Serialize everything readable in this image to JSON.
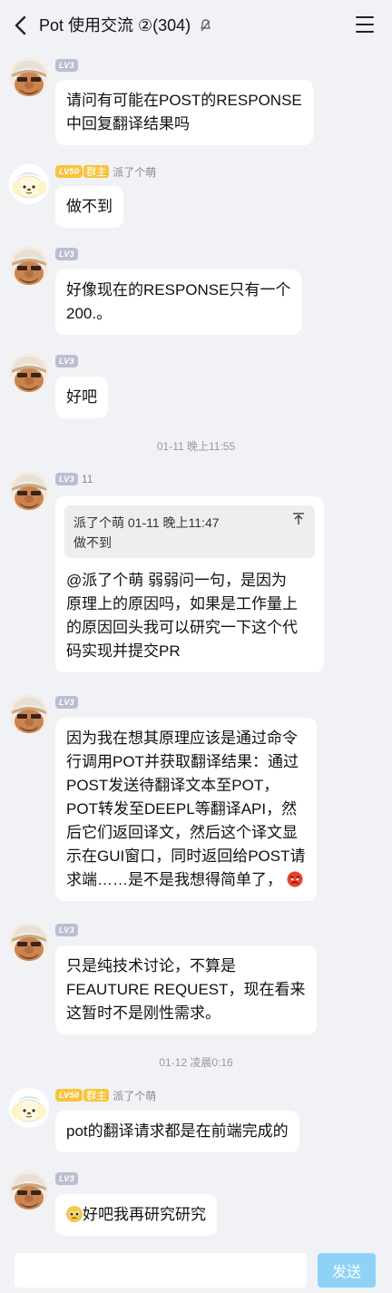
{
  "header": {
    "title": "Pot 使用交流 ②(304)"
  },
  "messages": [
    {
      "level": "LV3",
      "lines": [
        "请问有可能在POST的RESPONSE",
        "中回复翻译结果吗"
      ]
    },
    {
      "level": "LV50",
      "role": "群主",
      "name": "派了个萌",
      "lines": [
        "做不到"
      ]
    },
    {
      "level": "LV3",
      "lines": [
        "好像现在的RESPONSE只有一个",
        "200.。"
      ]
    },
    {
      "level": "LV3",
      "lines": [
        "好吧"
      ]
    },
    {
      "level": "LV3",
      "name": "11",
      "quote": {
        "header": "派了个萌 01-11 晚上11:47",
        "text": "做不到"
      },
      "lines": [
        "@派了个萌  弱弱问一句，是因为",
        "原理上的原因吗，如果是工作量上",
        "的原因回头我可以研究一下这个代",
        "码实现并提交PR"
      ]
    },
    {
      "level": "LV3",
      "lines": [
        "因为我在想其原理应该是通过命令",
        "行调用POT并获取翻译结果：通过",
        "POST发送待翻译文本至POT，",
        "POT转发至DEEPL等翻译API，然",
        "后它们返回译文，然后这个译文显",
        "示在GUI窗口，同时返回给POST请",
        "求端……是不是我想得简单了，"
      ]
    },
    {
      "level": "LV3",
      "lines": [
        "只是纯技术讨论，不算是",
        "FEAUTURE REQUEST，现在看来",
        "这暂时不是刚性需求。"
      ]
    },
    {
      "level": "LV50",
      "role": "群主",
      "name": "派了个萌",
      "lines": [
        "pot的翻译请求都是在前端完成的"
      ]
    },
    {
      "level": "LV3",
      "lines": [
        "好吧我再研究研究"
      ]
    }
  ],
  "timestamps": [
    "01-11 晚上11:55",
    "01-12 凌晨0:16"
  ],
  "icons": {
    "back": "chevron-left-icon",
    "mute": "mute-bell-icon",
    "menu": "hamburger-menu-icon",
    "collapse": "collapse-up-icon",
    "angry": "angry-face-emoji",
    "pleading": "pleading-face-emoji"
  },
  "composer": {
    "placeholder": "",
    "send_label": "发送"
  },
  "colors": {
    "background": "#f1f2f6",
    "bubble": "#ffffff",
    "level_badge": "#b9bfd0",
    "owner_badge": "#f6c43f",
    "send_button": "#8fd2f7"
  }
}
